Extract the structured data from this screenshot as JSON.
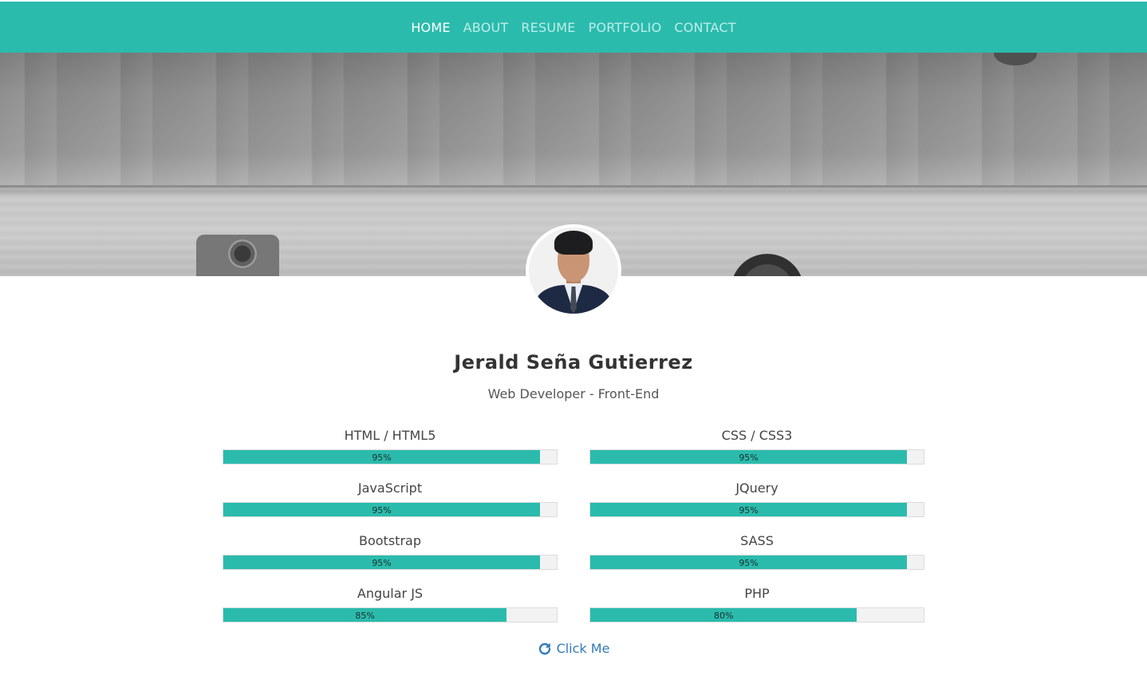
{
  "nav": {
    "items": [
      {
        "label": "HOME",
        "active": true
      },
      {
        "label": "ABOUT",
        "active": false
      },
      {
        "label": "RESUME",
        "active": false
      },
      {
        "label": "PORTFOLIO",
        "active": false
      },
      {
        "label": "CONTACT",
        "active": false
      }
    ]
  },
  "profile": {
    "name": "Jerald Seña Gutierrez",
    "role": "Web Developer - Front-End"
  },
  "skills": [
    {
      "name": "HTML / HTML5",
      "percent": 95,
      "label": "95%"
    },
    {
      "name": "CSS / CSS3",
      "percent": 95,
      "label": "95%"
    },
    {
      "name": "JavaScript",
      "percent": 95,
      "label": "95%"
    },
    {
      "name": "JQuery",
      "percent": 95,
      "label": "95%"
    },
    {
      "name": "Bootstrap",
      "percent": 95,
      "label": "95%"
    },
    {
      "name": "SASS",
      "percent": 95,
      "label": "95%"
    },
    {
      "name": "Angular JS",
      "percent": 85,
      "label": "85%"
    },
    {
      "name": "PHP",
      "percent": 80,
      "label": "80%"
    }
  ],
  "cta": {
    "label": "Click Me",
    "icon": "refresh-icon"
  },
  "colors": {
    "accent": "#2bbbad",
    "link": "#337ab7"
  }
}
